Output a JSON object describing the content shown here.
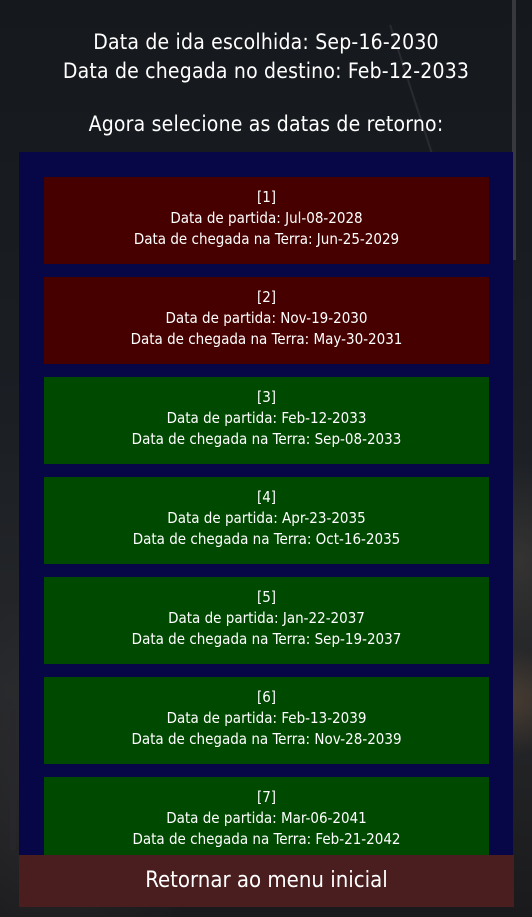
{
  "header": {
    "departure_line": "Data de ida escolhida: Sep-16-2030",
    "arrival_line": "Data de chegada no destino: Feb-12-2033",
    "instruction": "Agora selecione as datas de retorno:"
  },
  "colors": {
    "panel_bg": "#070747",
    "unavailable_option": "#470000",
    "available_option": "#004900",
    "back_button": "#4a1e1f"
  },
  "return_options": [
    {
      "index_label": "[1]",
      "departure": "Data de partida: Jul-08-2028",
      "arrival": "Data de chegada na Terra: Jun-25-2029",
      "status": "unavailable"
    },
    {
      "index_label": "[2]",
      "departure": "Data de partida: Nov-19-2030",
      "arrival": "Data de chegada na Terra: May-30-2031",
      "status": "unavailable"
    },
    {
      "index_label": "[3]",
      "departure": "Data de partida: Feb-12-2033",
      "arrival": "Data de chegada na Terra: Sep-08-2033",
      "status": "available"
    },
    {
      "index_label": "[4]",
      "departure": "Data de partida: Apr-23-2035",
      "arrival": "Data de chegada na Terra: Oct-16-2035",
      "status": "available"
    },
    {
      "index_label": "[5]",
      "departure": "Data de partida: Jan-22-2037",
      "arrival": "Data de chegada na Terra: Sep-19-2037",
      "status": "available"
    },
    {
      "index_label": "[6]",
      "departure": "Data de partida: Feb-13-2039",
      "arrival": "Data de chegada na Terra: Nov-28-2039",
      "status": "available"
    },
    {
      "index_label": "[7]",
      "departure": "Data de partida: Mar-06-2041",
      "arrival": "Data de chegada na Terra: Feb-21-2042",
      "status": "available"
    }
  ],
  "back_button": {
    "label": "Retornar ao menu inicial"
  }
}
